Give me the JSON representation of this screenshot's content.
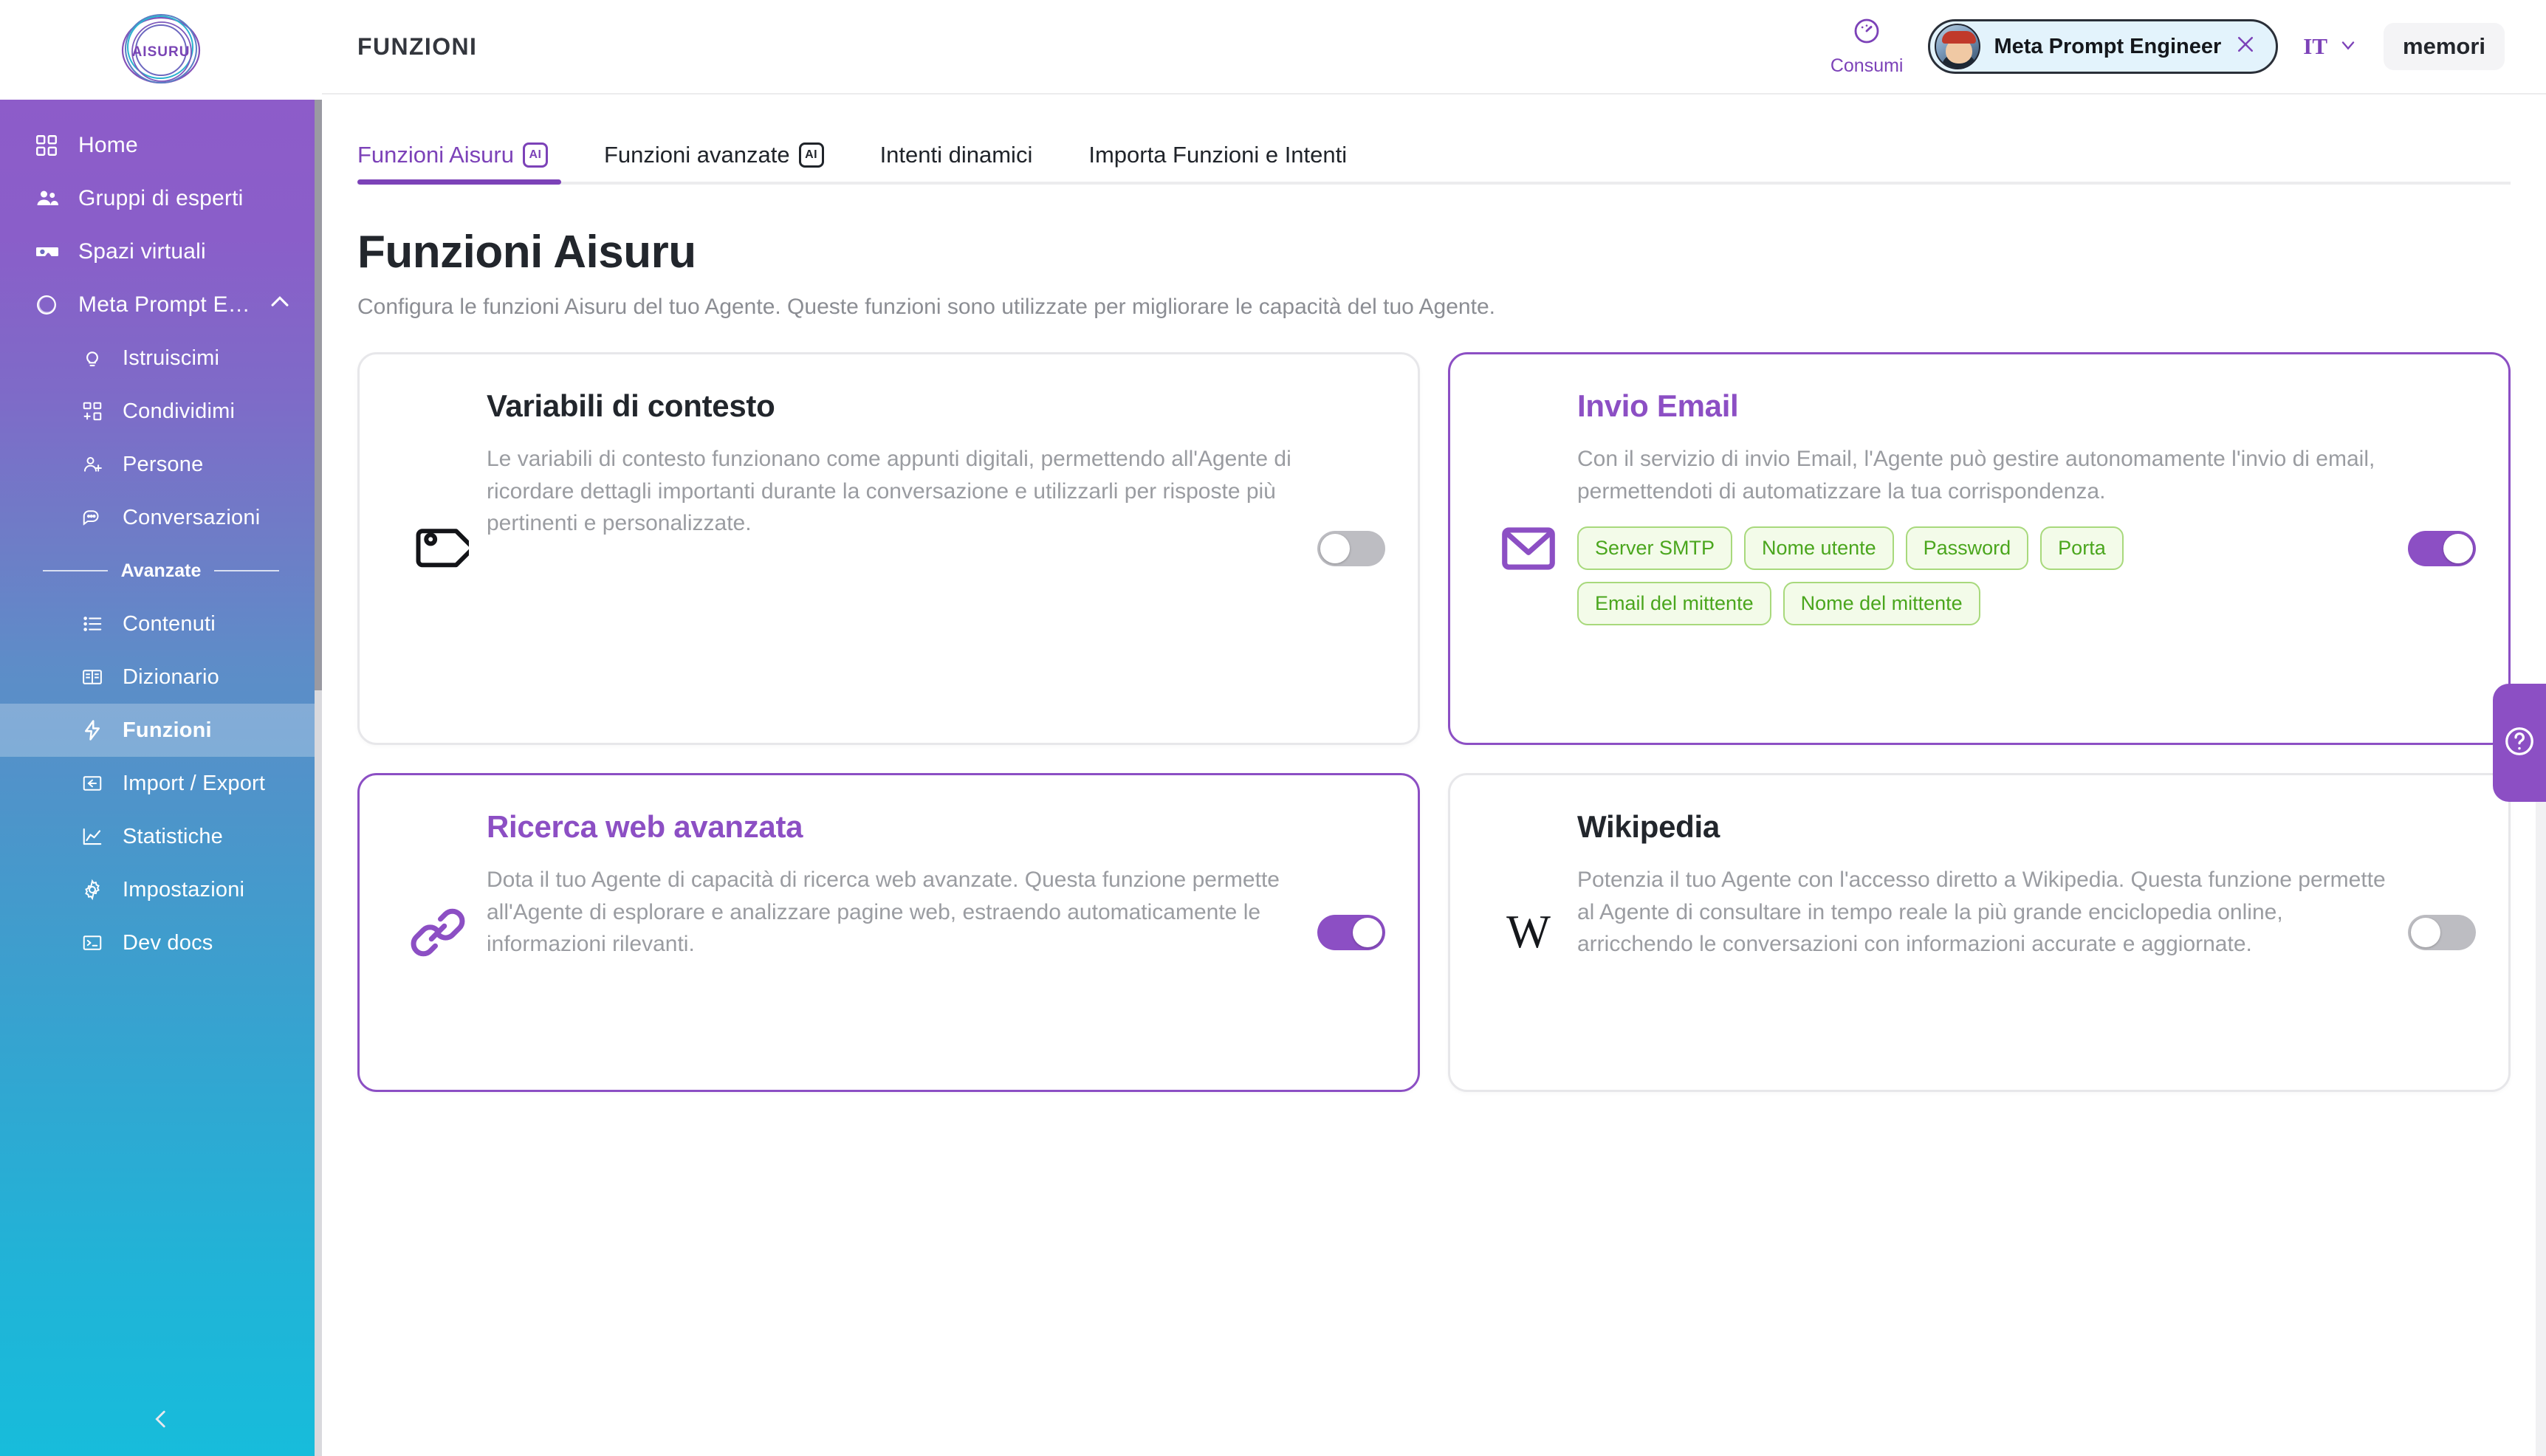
{
  "brand": {
    "logo_text": "AISURU"
  },
  "sidebar": {
    "items": [
      {
        "label": "Home",
        "icon": "grid-icon"
      },
      {
        "label": "Gruppi di esperti",
        "icon": "people-group-icon"
      },
      {
        "label": "Spazi virtuali",
        "icon": "vr-goggles-icon"
      },
      {
        "label": "Meta Prompt E…",
        "icon": "circle-sketch-icon",
        "expanded": true
      }
    ],
    "sub_items": [
      {
        "label": "Istruiscimi",
        "icon": "lightbulb-icon"
      },
      {
        "label": "Condividimi",
        "icon": "share-grid-icon"
      },
      {
        "label": "Persone",
        "icon": "person-add-icon"
      },
      {
        "label": "Conversazioni",
        "icon": "chat-bubble-icon"
      }
    ],
    "separator_label": "Avanzate",
    "advanced_items": [
      {
        "label": "Contenuti",
        "icon": "list-icon",
        "active": false
      },
      {
        "label": "Dizionario",
        "icon": "book-icon",
        "active": false
      },
      {
        "label": "Funzioni",
        "icon": "lightning-bolt-icon",
        "active": true
      },
      {
        "label": "Import / Export",
        "icon": "import-export-icon",
        "active": false
      },
      {
        "label": "Statistiche",
        "icon": "chart-line-icon",
        "active": false
      },
      {
        "label": "Impostazioni",
        "icon": "gear-icon",
        "active": false
      },
      {
        "label": "Dev docs",
        "icon": "terminal-icon",
        "active": false
      }
    ],
    "collapse_icon": "chevron-left-icon"
  },
  "topbar": {
    "breadcrumb": "FUNZIONI",
    "consumi_label": "Consumi",
    "consumi_icon": "gauge-icon",
    "agent_name": "Meta Prompt Engineer",
    "agent_close_icon": "close-icon",
    "language": "IT",
    "language_chevron": "chevron-down-icon",
    "memori_label": "memori"
  },
  "tabs": [
    {
      "label": "Funzioni Aisuru",
      "badge": "AI",
      "active": true
    },
    {
      "label": "Funzioni avanzate",
      "badge": "AI",
      "active": false
    },
    {
      "label": "Intenti dinamici",
      "badge": null,
      "active": false
    },
    {
      "label": "Importa Funzioni e Intenti",
      "badge": null,
      "active": false
    }
  ],
  "page": {
    "title": "Funzioni Aisuru",
    "subtitle": "Configura le funzioni Aisuru del tuo Agente. Queste funzioni sono utilizzate per migliorare le capacità del tuo Agente."
  },
  "cards": [
    {
      "title": "Variabili di contesto",
      "description": "Le variabili di contesto funzionano come appunti digitali, permettendo all'Agente di ricordare dettagli importanti durante la conversazione e utilizzarli per risposte più pertinenti e personalizzate.",
      "icon": "tag-icon",
      "enabled": false,
      "chips": []
    },
    {
      "title": "Invio Email",
      "description": "Con il servizio di invio Email, l'Agente può gestire autonomamente l'invio di email, permettendoti di automatizzare la tua corrispondenza.",
      "icon": "envelope-icon",
      "enabled": true,
      "chips": [
        "Server SMTP",
        "Nome utente",
        "Password",
        "Porta",
        "Email del mittente",
        "Nome del mittente"
      ]
    },
    {
      "title": "Ricerca web avanzata",
      "description": "Dota il tuo Agente di capacità di ricerca web avanzate. Questa funzione permette all'Agente di esplorare e analizzare pagine web, estraendo automaticamente le informazioni rilevanti.",
      "icon": "link-chain-icon",
      "enabled": true,
      "chips": []
    },
    {
      "title": "Wikipedia",
      "description": "Potenzia il tuo Agente con l'accesso diretto a Wikipedia. Questa funzione permette al Agente di consultare in tempo reale la più grande enciclopedia online, arricchendo le conversazioni con informazioni accurate e aggiornate.",
      "icon": "wikipedia-w-icon",
      "enabled": false,
      "chips": []
    }
  ],
  "help": {
    "icon": "question-mark-icon"
  },
  "colors": {
    "accent_purple": "#8c4fc4",
    "tab_purple": "#7c42b8",
    "chip_green_text": "#4aa61d",
    "chip_green_bg": "#f3fbe9",
    "chip_green_border": "#a8d97c",
    "sidebar_top": "#8d5cc9",
    "sidebar_bottom": "#17bcdb",
    "text_dark": "#22262c",
    "text_muted": "#9a9ca1"
  }
}
